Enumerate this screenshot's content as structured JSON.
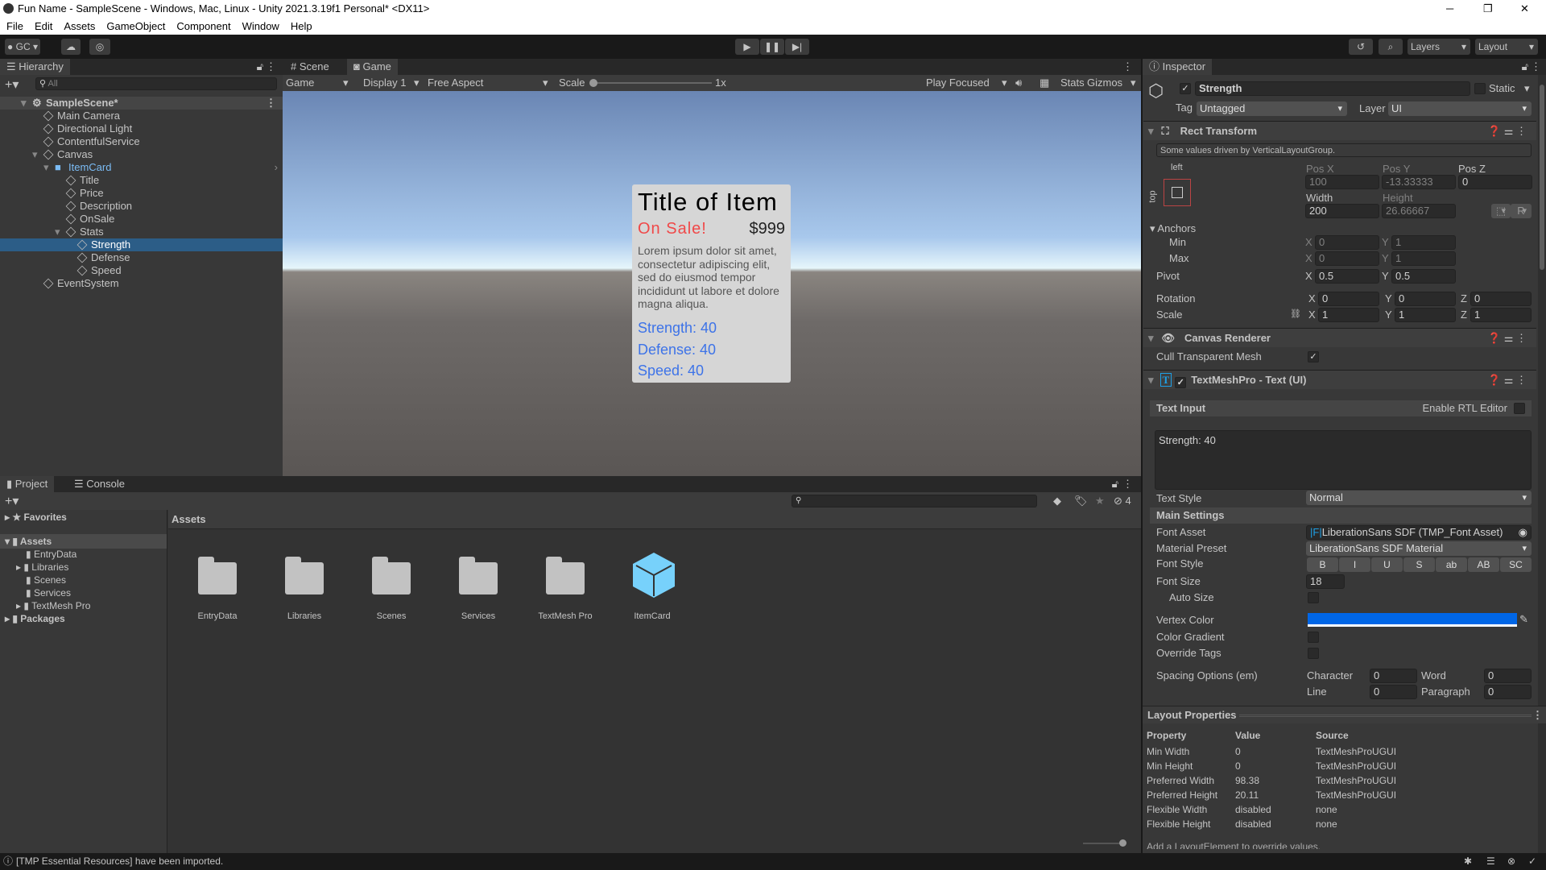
{
  "window": {
    "title": "Fun Name - SampleScene - Windows, Mac, Linux - Unity 2021.3.19f1 Personal* <DX11>"
  },
  "menu": [
    "File",
    "Edit",
    "Assets",
    "GameObject",
    "Component",
    "Window",
    "Help"
  ],
  "toolbar": {
    "account": "GC",
    "layers": "Layers",
    "layout": "Layout"
  },
  "hierarchy": {
    "tab": "Hierarchy",
    "search_placeholder": "All",
    "items": [
      {
        "label": "SampleScene*",
        "depth": 0
      },
      {
        "label": "Main Camera",
        "depth": 1
      },
      {
        "label": "Directional Light",
        "depth": 1
      },
      {
        "label": "ContentfulService",
        "depth": 1
      },
      {
        "label": "Canvas",
        "depth": 1
      },
      {
        "label": "ItemCard",
        "depth": 2
      },
      {
        "label": "Title",
        "depth": 3
      },
      {
        "label": "Price",
        "depth": 3
      },
      {
        "label": "Description",
        "depth": 3
      },
      {
        "label": "OnSale",
        "depth": 3
      },
      {
        "label": "Stats",
        "depth": 3
      },
      {
        "label": "Strength",
        "depth": 4
      },
      {
        "label": "Defense",
        "depth": 4
      },
      {
        "label": "Speed",
        "depth": 4
      },
      {
        "label": "EventSystem",
        "depth": 1
      }
    ]
  },
  "game": {
    "tabs": [
      "Scene",
      "Game"
    ],
    "mode": "Game",
    "display": "Display 1",
    "aspect": "Free Aspect",
    "scale_label": "Scale",
    "scale_value": "1x",
    "play_mode": "Play Focused",
    "stats": "Stats",
    "gizmos": "Gizmos",
    "card": {
      "title": "Title of Item",
      "sale": "On Sale!",
      "price": "$999",
      "description": "Lorem ipsum dolor sit amet, consectetur adipiscing elit, sed do eiusmod tempor incididunt ut labore et dolore magna aliqua.",
      "stats": [
        "Strength: 40",
        "Defense: 40",
        "Speed: 40"
      ]
    }
  },
  "project": {
    "tabs": [
      "Project",
      "Console"
    ],
    "hidden_count": "4",
    "breadcrumb": "Assets",
    "tree": [
      "Favorites",
      "Assets",
      "EntryData",
      "Libraries",
      "Scenes",
      "Services",
      "TextMesh Pro",
      "Packages"
    ],
    "assets": [
      "EntryData",
      "Libraries",
      "Scenes",
      "Services",
      "TextMesh Pro",
      "ItemCard"
    ]
  },
  "inspector": {
    "tab": "Inspector",
    "name": "Strength",
    "static": "Static",
    "tag_label": "Tag",
    "tag": "Untagged",
    "layer_label": "Layer",
    "layer": "UI",
    "rect": {
      "title": "Rect Transform",
      "note": "Some values driven by VerticalLayoutGroup.",
      "anchor_h": "left",
      "anchor_v": "top",
      "posx_label": "Pos X",
      "posy_label": "Pos Y",
      "posz_label": "Pos Z",
      "posx": "100",
      "posy": "-13.33333",
      "posz": "0",
      "width_label": "Width",
      "height_label": "Height",
      "width": "200",
      "height": "26.66667",
      "r": "R",
      "anchors": "Anchors",
      "min": "Min",
      "max": "Max",
      "min_x": "0",
      "min_y": "1",
      "max_x": "0",
      "max_y": "1",
      "pivot": "Pivot",
      "pivot_x": "0.5",
      "pivot_y": "0.5",
      "rotation": "Rotation",
      "rot": [
        "0",
        "0",
        "0"
      ],
      "scale": "Scale",
      "scl": [
        "1",
        "1",
        "1"
      ],
      "x": "X",
      "y": "Y",
      "z": "Z"
    },
    "canvas_renderer": {
      "title": "Canvas Renderer",
      "cull": "Cull Transparent Mesh"
    },
    "tmp": {
      "title": "TextMeshPro - Text (UI)",
      "text_input": "Text Input",
      "rtl": "Enable RTL Editor",
      "text": "Strength: 40",
      "text_style_label": "Text Style",
      "text_style": "Normal",
      "main_settings": "Main Settings",
      "font_asset_label": "Font Asset",
      "font_asset": "LiberationSans SDF (TMP_Font Asset)",
      "material_label": "Material Preset",
      "material": "LiberationSans SDF Material",
      "font_style_label": "Font Style",
      "font_styles": [
        "B",
        "I",
        "U",
        "S",
        "ab",
        "AB",
        "SC"
      ],
      "font_size_label": "Font Size",
      "font_size": "18",
      "auto_size": "Auto Size",
      "vertex_color_label": "Vertex Color",
      "vertex_color": "#0066e6",
      "color_gradient": "Color Gradient",
      "override_tags": "Override Tags",
      "spacing": "Spacing Options (em)",
      "character": "Character",
      "word": "Word",
      "line": "Line",
      "paragraph": "Paragraph",
      "character_v": "0",
      "word_v": "0",
      "line_v": "0",
      "paragraph_v": "0"
    }
  },
  "layout_props": {
    "title": "Layout Properties",
    "headers": [
      "Property",
      "Value",
      "Source"
    ],
    "rows": [
      [
        "Min Width",
        "0",
        "TextMeshProUGUI"
      ],
      [
        "Min Height",
        "0",
        "TextMeshProUGUI"
      ],
      [
        "Preferred Width",
        "98.38",
        "TextMeshProUGUI"
      ],
      [
        "Preferred Height",
        "20.11",
        "TextMeshProUGUI"
      ],
      [
        "Flexible Width",
        "disabled",
        "none"
      ],
      [
        "Flexible Height",
        "disabled",
        "none"
      ]
    ],
    "footer": "Add a LayoutElement to override values."
  },
  "status": {
    "message": "[TMP Essential Resources] have been imported."
  }
}
